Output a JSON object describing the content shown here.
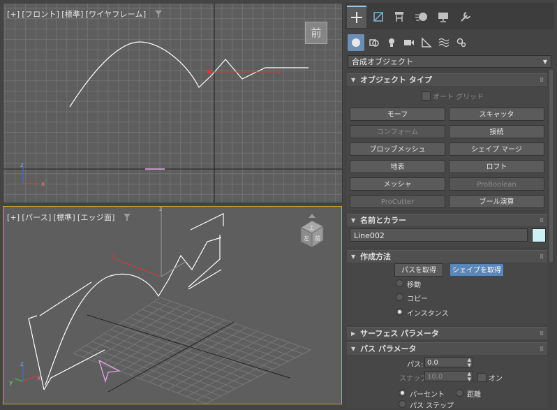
{
  "viewport_front": {
    "label": [
      "[+]",
      "[フロント]",
      "[標準]",
      "[ワイヤフレーム]"
    ],
    "viewcube_face": "前",
    "axis_x": "x",
    "axis_z": "z"
  },
  "viewport_persp": {
    "label": [
      "[+]",
      "[パース]",
      "[標準]",
      "[エッジ面]"
    ],
    "axis_x": "x",
    "axis_y": "y",
    "axis_z": "z",
    "viewcube_top": "上",
    "viewcube_left": "左",
    "viewcube_front": "前"
  },
  "command_panel": {
    "main_tabs": [
      "create-icon",
      "modify-icon",
      "hierarchy-icon",
      "motion-icon",
      "display-icon",
      "utilities-icon"
    ],
    "sub_tabs": [
      "geometry-icon",
      "shapes-icon",
      "lights-icon",
      "cameras-icon",
      "helpers-icon",
      "spacewarps-icon",
      "systems-icon"
    ],
    "category": "合成オブジェクト",
    "object_type": {
      "title": "オブジェクト タイプ",
      "autogrid": "オート グリッド",
      "buttons": [
        {
          "label": "モーフ",
          "enabled": true
        },
        {
          "label": "スキャッタ",
          "enabled": true
        },
        {
          "label": "コンフォーム",
          "enabled": false
        },
        {
          "label": "接続",
          "enabled": true
        },
        {
          "label": "ブロッブメッシュ",
          "enabled": true
        },
        {
          "label": "シェイプ マージ",
          "enabled": true
        },
        {
          "label": "地表",
          "enabled": true
        },
        {
          "label": "ロフト",
          "enabled": true
        },
        {
          "label": "メッシャ",
          "enabled": true
        },
        {
          "label": "ProBoolean",
          "enabled": false
        },
        {
          "label": "ProCutter",
          "enabled": false
        },
        {
          "label": "ブール演算",
          "enabled": true
        }
      ]
    },
    "name_color": {
      "title": "名前とカラー",
      "name": "Line002",
      "color": "#cdf0f4"
    },
    "creation_method": {
      "title": "作成方法",
      "get_path": "パスを取得",
      "get_shape": "シェイプを取得",
      "options": [
        {
          "label": "移動",
          "selected": false
        },
        {
          "label": "コピー",
          "selected": false
        },
        {
          "label": "インスタンス",
          "selected": true
        }
      ]
    },
    "surface_params": {
      "title": "サーフェス パラメータ"
    },
    "path_params": {
      "title": "パス パラメータ",
      "path_label": "パス:",
      "path_value": "0.0",
      "snap_label": "スナップ:",
      "snap_value": "10.0",
      "on_label": "オン",
      "percent_label": "パーセント",
      "distance_label": "距離",
      "path_steps_label": "パス ステップ"
    }
  }
}
